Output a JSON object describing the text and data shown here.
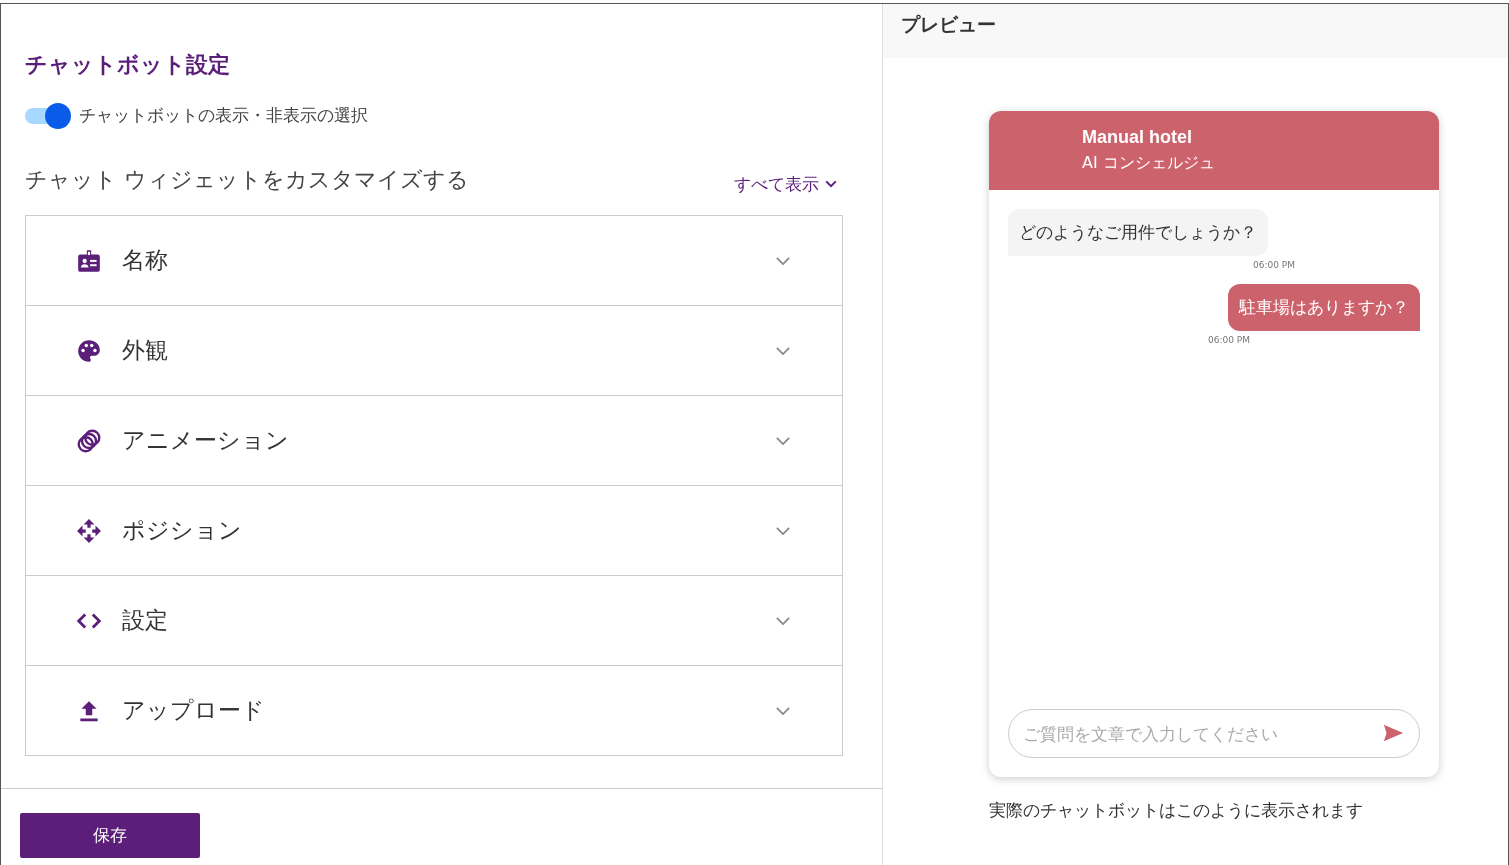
{
  "settings": {
    "title": "チャットボット設定",
    "visibility_toggle": {
      "label": "チャットボットの表示・非表示の選択",
      "on": true
    },
    "customize_heading": "チャット ウィジェットをカスタマイズする",
    "show_all": "すべて表示",
    "sections": [
      {
        "kind": "name",
        "label": "名称",
        "expanded": false
      },
      {
        "kind": "appearance",
        "label": "外観",
        "expanded": false
      },
      {
        "kind": "animation",
        "label": "アニメーション",
        "expanded": false
      },
      {
        "kind": "position",
        "label": "ポジション",
        "expanded": false
      },
      {
        "kind": "code",
        "label": "設定",
        "expanded": false
      },
      {
        "kind": "upload",
        "label": "アップロード",
        "expanded": false
      }
    ],
    "save_button": "保存"
  },
  "preview": {
    "title": "プレビュー",
    "chat": {
      "name": "Manual hotel",
      "subtitle": "AI コンシェルジュ",
      "color": "#cc626b",
      "messages": [
        {
          "kind": "bot",
          "text": "どのようなご用件でしょうか？",
          "time": "06:00 PM"
        },
        {
          "kind": "user",
          "text": "駐車場はありますか？",
          "time": "06:00 PM"
        }
      ],
      "input": {
        "placeholder": "ご質問を文章で入力してください"
      }
    },
    "caption": "実際のチャットボットはこのように表示されます"
  }
}
